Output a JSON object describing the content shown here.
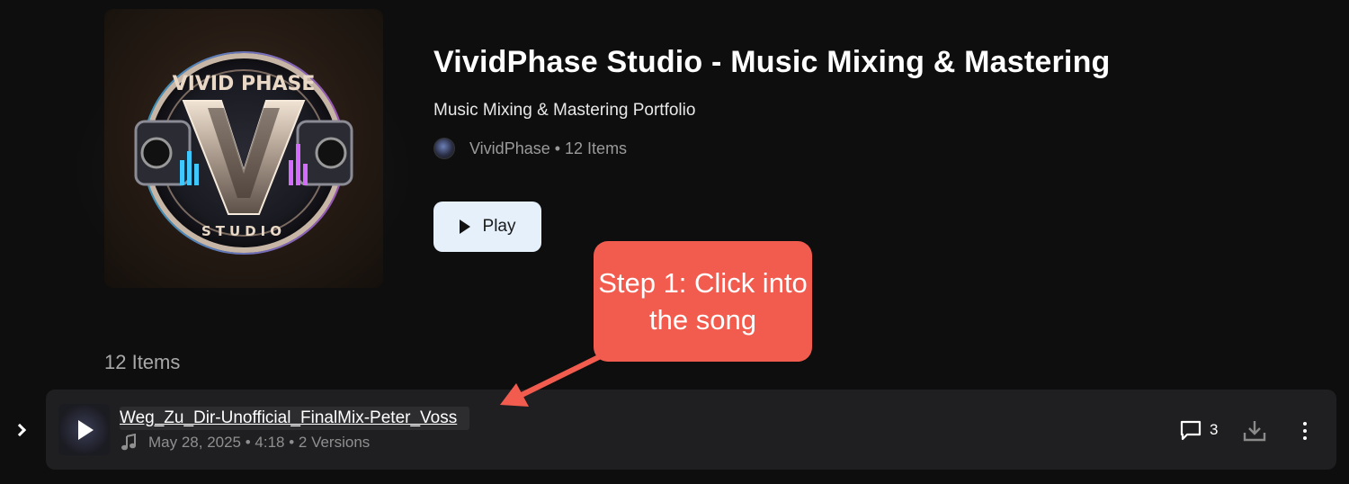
{
  "playlist": {
    "title": "VividPhase Studio - Music Mixing & Mastering",
    "subtitle": "Music Mixing & Mastering Portfolio",
    "meta": "VividPhase • 12 Items",
    "play_label": "Play",
    "count_label": "12 Items",
    "cover_logo_text": {
      "top": "VIVID PHASE",
      "bottom": "STUDIO"
    }
  },
  "track": {
    "title": "Weg_Zu_Dir-Unofficial_FinalMix-Peter_Voss",
    "meta": "May 28, 2025 • 4:18 • 2 Versions",
    "comment_count": "3"
  },
  "callout": {
    "text": "Step 1: Click into the song",
    "color": "#f25c4f"
  },
  "icons": {
    "expand": "chevron-right-icon",
    "thumb": "play-icon",
    "meta": "music-note-icon",
    "comments": "comment-icon",
    "download": "download-icon",
    "more": "more-vertical-icon"
  },
  "colors": {
    "background": "#0e0e0e",
    "row_background": "#1f1f21",
    "play_button": "#e6f0fb"
  }
}
